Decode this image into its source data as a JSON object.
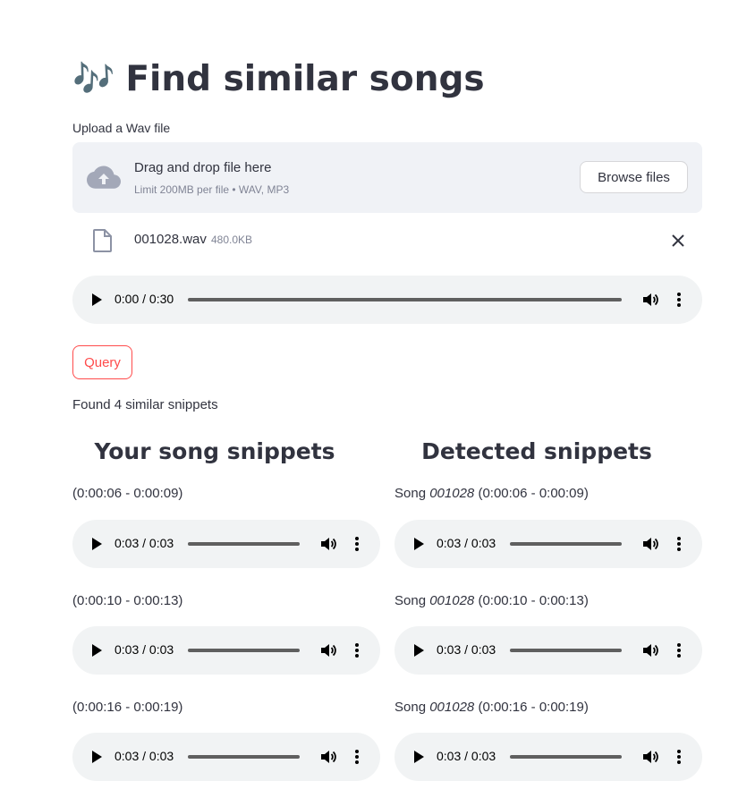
{
  "page": {
    "title_emoji": "🎶",
    "title": "Find similar songs"
  },
  "uploader": {
    "label": "Upload a Wav file",
    "drop_text": "Drag and drop file here",
    "limit_text": "Limit 200MB per file • WAV, MP3",
    "browse_label": "Browse files",
    "icon": "cloud-upload-icon"
  },
  "uploaded_file": {
    "name": "001028.wav",
    "size": "480.0KB",
    "icon": "file-icon",
    "remove_icon": "close-icon"
  },
  "main_player": {
    "time": "0:00 / 0:30",
    "progress": 0.0
  },
  "query_button": {
    "label": "Query",
    "color": "#ff4b4b"
  },
  "result_summary": "Found 4 similar snippets",
  "columns": {
    "left_heading": "Your song snippets",
    "right_heading": "Detected snippets"
  },
  "snippets": [
    {
      "your_range": "(0:00:06 - 0:00:09)",
      "detected_prefix": "Song",
      "detected_song": "001028",
      "detected_range": "(0:00:06 - 0:00:09)",
      "your_time": "0:03 / 0:03",
      "detected_time": "0:03 / 0:03"
    },
    {
      "your_range": "(0:00:10 - 0:00:13)",
      "detected_prefix": "Song",
      "detected_song": "001028",
      "detected_range": "(0:00:10 - 0:00:13)",
      "your_time": "0:03 / 0:03",
      "detected_time": "0:03 / 0:03"
    },
    {
      "your_range": "(0:00:16 - 0:00:19)",
      "detected_prefix": "Song",
      "detected_song": "001028",
      "detected_range": "(0:00:16 - 0:00:19)",
      "your_time": "0:03 / 0:03",
      "detected_time": "0:03 / 0:03"
    }
  ]
}
